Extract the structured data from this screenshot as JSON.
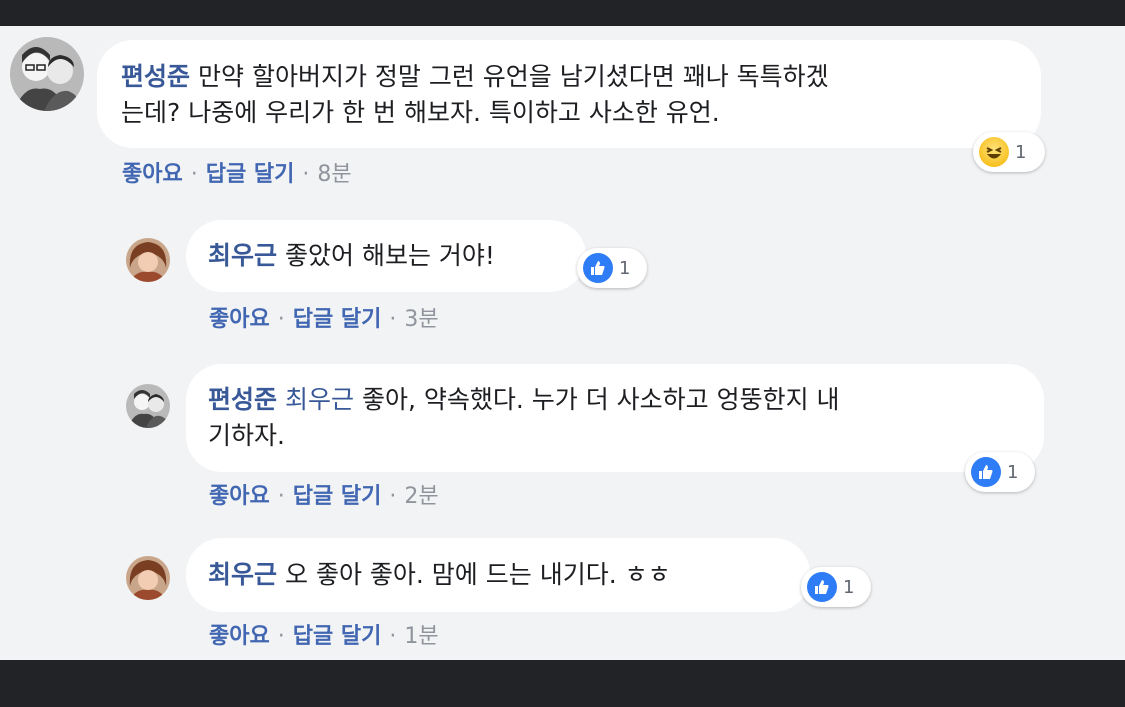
{
  "comments": [
    {
      "author": "편성준",
      "line1": "만약 할아버지가 정말 그런 유언을 남기셨다면 꽤나 독특하겠",
      "line2": "는데? 나중에 우리가 한 번 해보자. 특이하고 사소한 유언.",
      "like_label": "좋아요",
      "reply_label": "답글 달기",
      "time": "8분",
      "reaction": "haha-icon",
      "reaction_count": "1"
    },
    {
      "author": "최우근",
      "line1": "좋았어 해보는 거야!",
      "like_label": "좋아요",
      "reply_label": "답글 달기",
      "time": "3분",
      "reaction": "like-icon",
      "reaction_count": "1"
    },
    {
      "author": "편성준",
      "mention": "최우근",
      "line1": "좋아, 약속했다. 누가 더 사소하고 엉뚱한지 내",
      "line2": "기하자.",
      "like_label": "좋아요",
      "reply_label": "답글 달기",
      "time": "2분",
      "reaction": "like-icon",
      "reaction_count": "1"
    },
    {
      "author": "최우근",
      "line1": "오 좋아 좋아. 맘에 드는 내기다. ㅎㅎ",
      "like_label": "좋아요",
      "reply_label": "답글 달기",
      "time": "1분",
      "reaction": "like-icon",
      "reaction_count": "1"
    }
  ],
  "separator": "·",
  "colors": {
    "background": "#222326",
    "panel": "#f2f3f5",
    "author": "#385898",
    "action_link": "#4267b2",
    "like_blue": "#2e7cf6"
  }
}
